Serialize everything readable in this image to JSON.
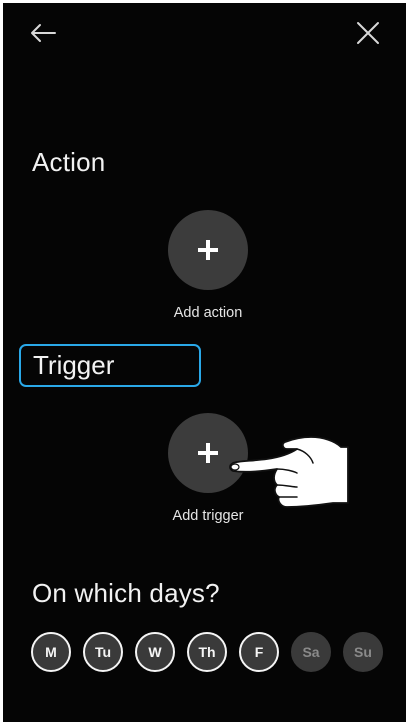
{
  "header": {
    "back_icon": "arrow-left-icon",
    "close_icon": "close-icon"
  },
  "action": {
    "title": "Action",
    "add_label": "Add action",
    "add_icon": "plus-icon"
  },
  "trigger": {
    "title": "Trigger",
    "add_label": "Add trigger",
    "add_icon": "plus-icon"
  },
  "days": {
    "title": "On which days?",
    "items": [
      {
        "label": "M",
        "selected": true
      },
      {
        "label": "Tu",
        "selected": true
      },
      {
        "label": "W",
        "selected": true
      },
      {
        "label": "Th",
        "selected": true
      },
      {
        "label": "F",
        "selected": true
      },
      {
        "label": "Sa",
        "selected": false
      },
      {
        "label": "Su",
        "selected": false
      }
    ]
  },
  "colors": {
    "background": "#050505",
    "focus_outline": "#2aa8e8",
    "button_fill": "#3c3c3c"
  }
}
